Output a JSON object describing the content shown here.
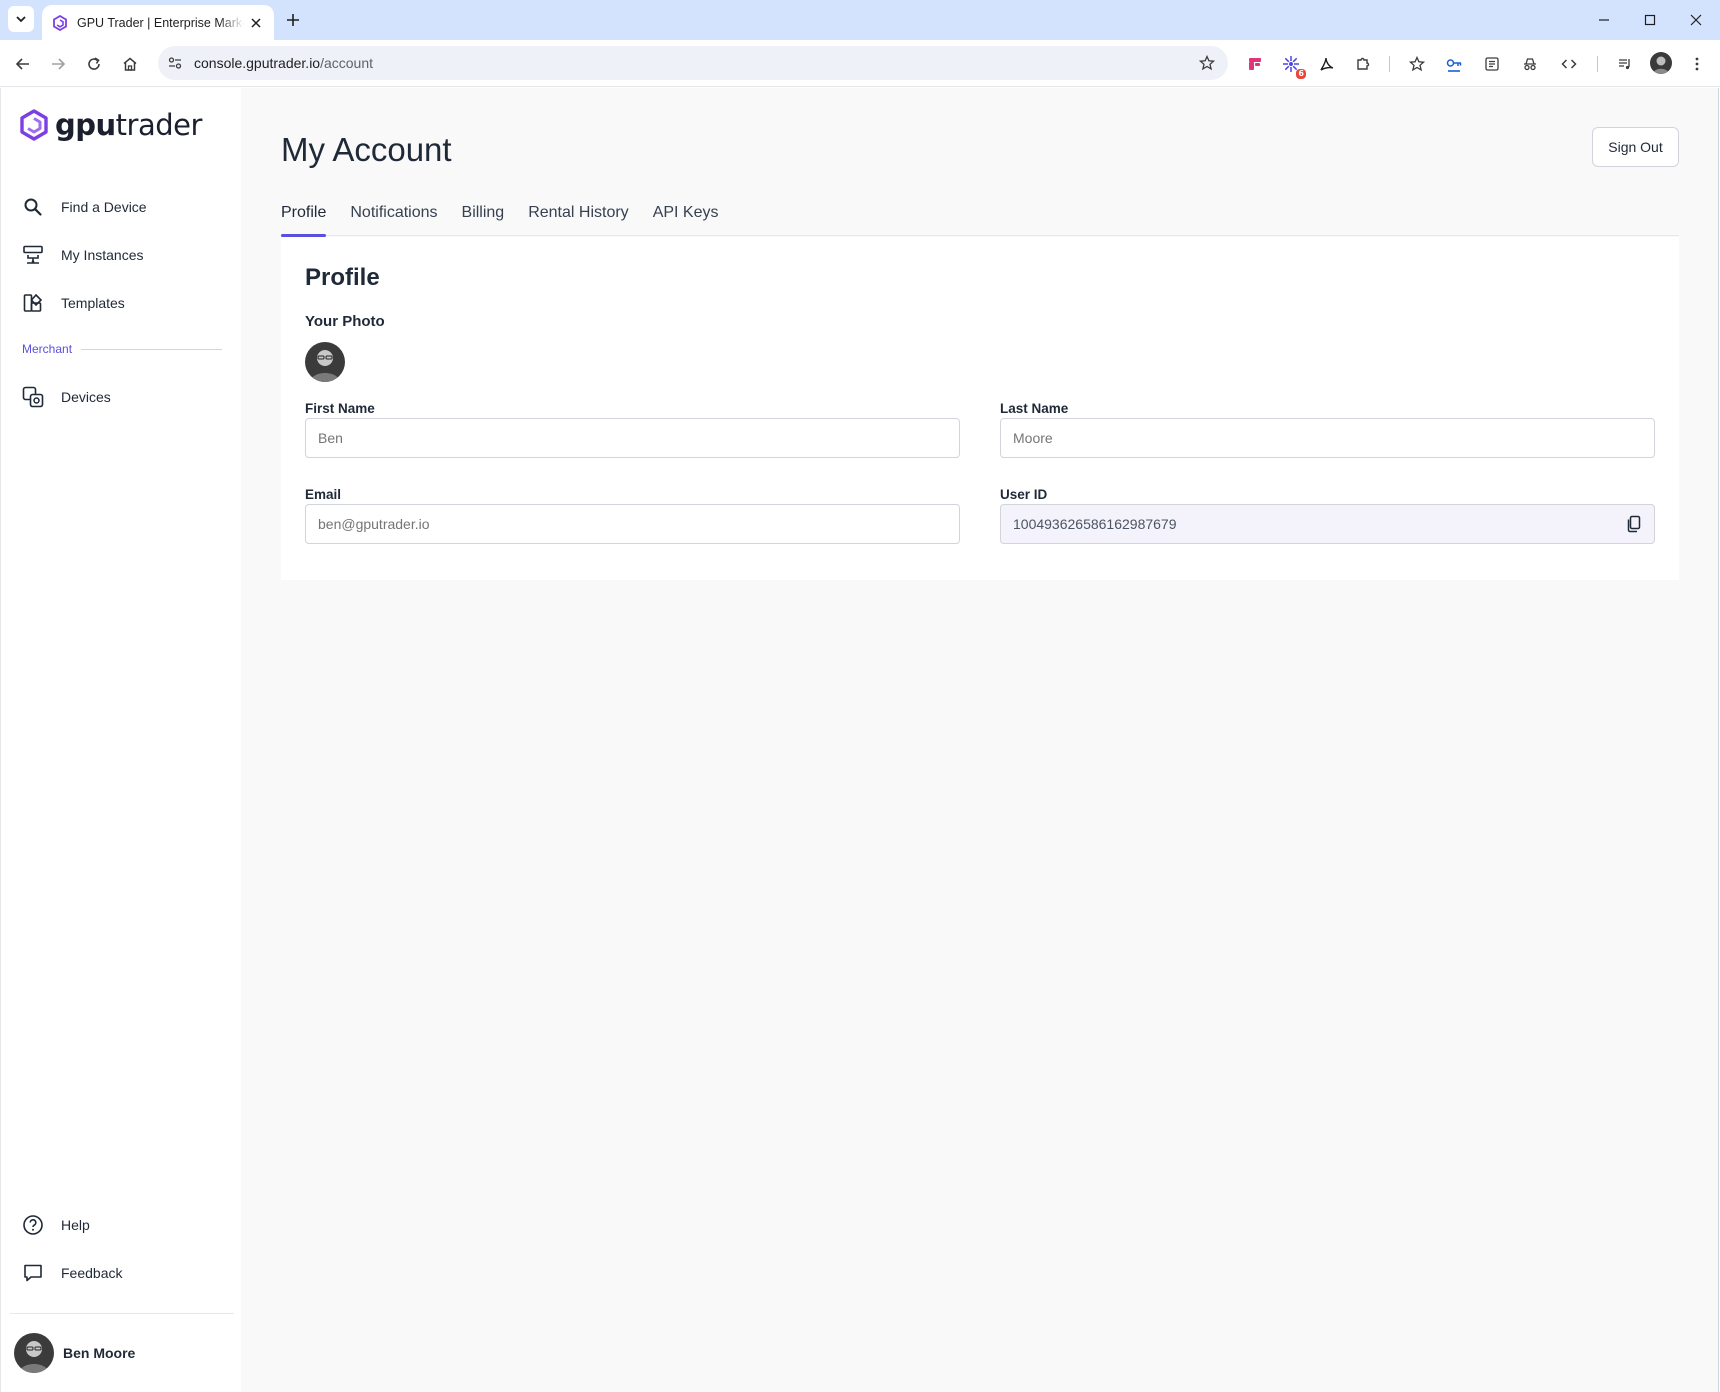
{
  "browser": {
    "tab_title": "GPU Trader | Enterprise Marketplace",
    "url_host": "console.gputrader.io",
    "url_path": "/account",
    "extension_badge": "6"
  },
  "sidebar": {
    "brand_bold": "gpu",
    "brand_light": "trader",
    "items": [
      {
        "label": "Find a Device",
        "icon": "search-icon"
      },
      {
        "label": "My Instances",
        "icon": "instances-icon"
      },
      {
        "label": "Templates",
        "icon": "templates-icon"
      }
    ],
    "section_label": "Merchant",
    "merchant_items": [
      {
        "label": "Devices",
        "icon": "devices-icon"
      }
    ],
    "footer_items": [
      {
        "label": "Help",
        "icon": "help-icon"
      },
      {
        "label": "Feedback",
        "icon": "feedback-icon"
      }
    ],
    "user_name": "Ben Moore"
  },
  "main": {
    "title": "My Account",
    "signout_label": "Sign Out",
    "tabs": [
      {
        "label": "Profile",
        "active": true
      },
      {
        "label": "Notifications",
        "active": false
      },
      {
        "label": "Billing",
        "active": false
      },
      {
        "label": "Rental History",
        "active": false
      },
      {
        "label": "API Keys",
        "active": false
      }
    ],
    "profile": {
      "heading": "Profile",
      "photo_label": "Your Photo",
      "first_name_label": "First Name",
      "first_name_placeholder": "Ben",
      "last_name_label": "Last Name",
      "last_name_placeholder": "Moore",
      "email_label": "Email",
      "email_placeholder": "ben@gputrader.io",
      "user_id_label": "User ID",
      "user_id_value": "100493626586162987679"
    }
  },
  "colors": {
    "accent": "#5b4fe0",
    "brand_purple": "#7b3fe4"
  }
}
